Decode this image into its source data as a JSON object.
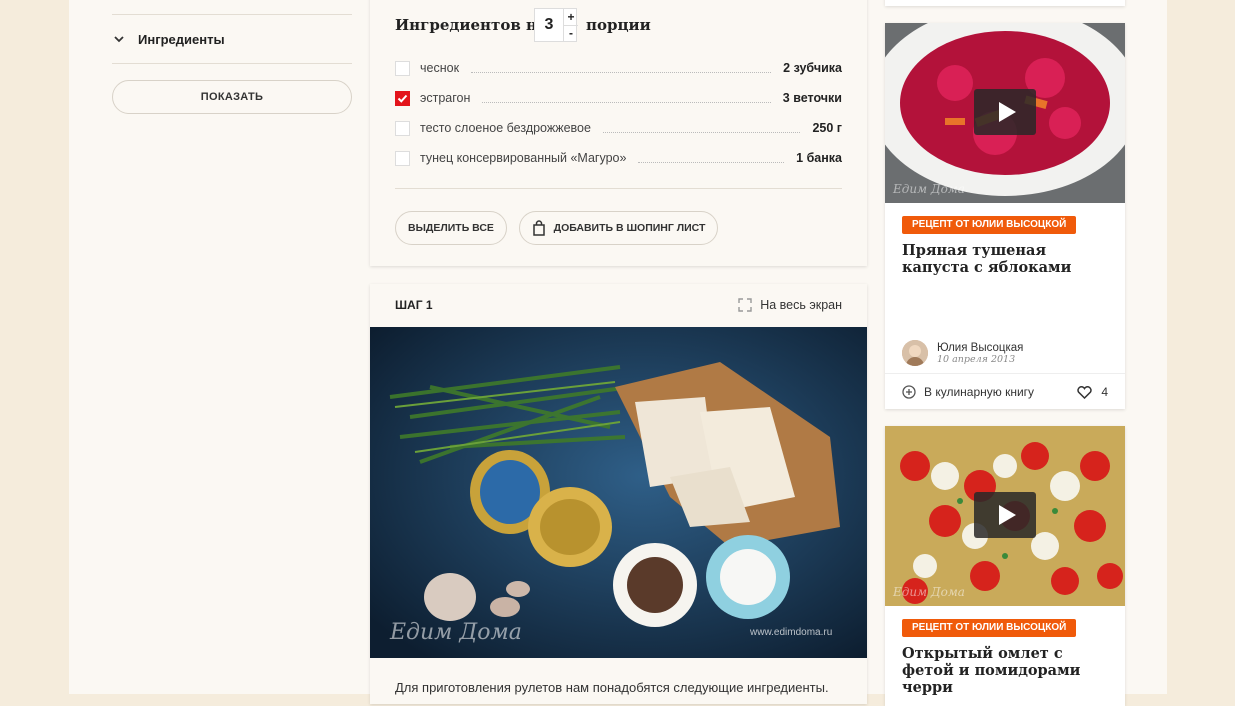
{
  "sidebar": {
    "filter_label": "Ингредиенты",
    "show_button": "ПОКАЗАТЬ"
  },
  "ingredients": {
    "title_prefix": "Ингредиентов на",
    "servings": "3",
    "title_suffix": "порции",
    "plus": "+",
    "minus": "-",
    "items": [
      {
        "name": "чеснок",
        "amount": "2 зубчика",
        "checked": false
      },
      {
        "name": "эстрагон",
        "amount": "3 веточки",
        "checked": true
      },
      {
        "name": "тесто слоеное бездрожжевое",
        "amount": "250 г",
        "checked": false
      },
      {
        "name": "тунец консервированный «Магуро»",
        "amount": "1 банка",
        "checked": false
      }
    ],
    "select_all": "ВЫДЕЛИТЬ ВСЕ",
    "add_to_list": "ДОБАВИТЬ В ШОПИНГ ЛИСТ"
  },
  "step": {
    "title": "ШАГ 1",
    "fullscreen": "На весь экран",
    "watermark_site": "www.edimdoma.ru",
    "text": "Для приготовления рулетов нам понадобятся следующие ингредиенты."
  },
  "recipes": [
    {
      "badge": "РЕЦЕПТ ОТ ЮЛИИ ВЫСОЦКОЙ",
      "title": "Пряная тушеная капуста с яблоками",
      "author": "Юлия Высоцкая",
      "date": "10 апреля 2013",
      "action": "В кулинарную книгу",
      "likes": "4"
    },
    {
      "badge": "РЕЦЕПТ ОТ ЮЛИИ ВЫСОЦКОЙ",
      "title": "Открытый омлет с фетой и помидорами черри"
    }
  ],
  "colors": {
    "accent_red": "#e3141b",
    "badge_orange": "#f05a0a",
    "page_bg": "#f5ecdc"
  }
}
